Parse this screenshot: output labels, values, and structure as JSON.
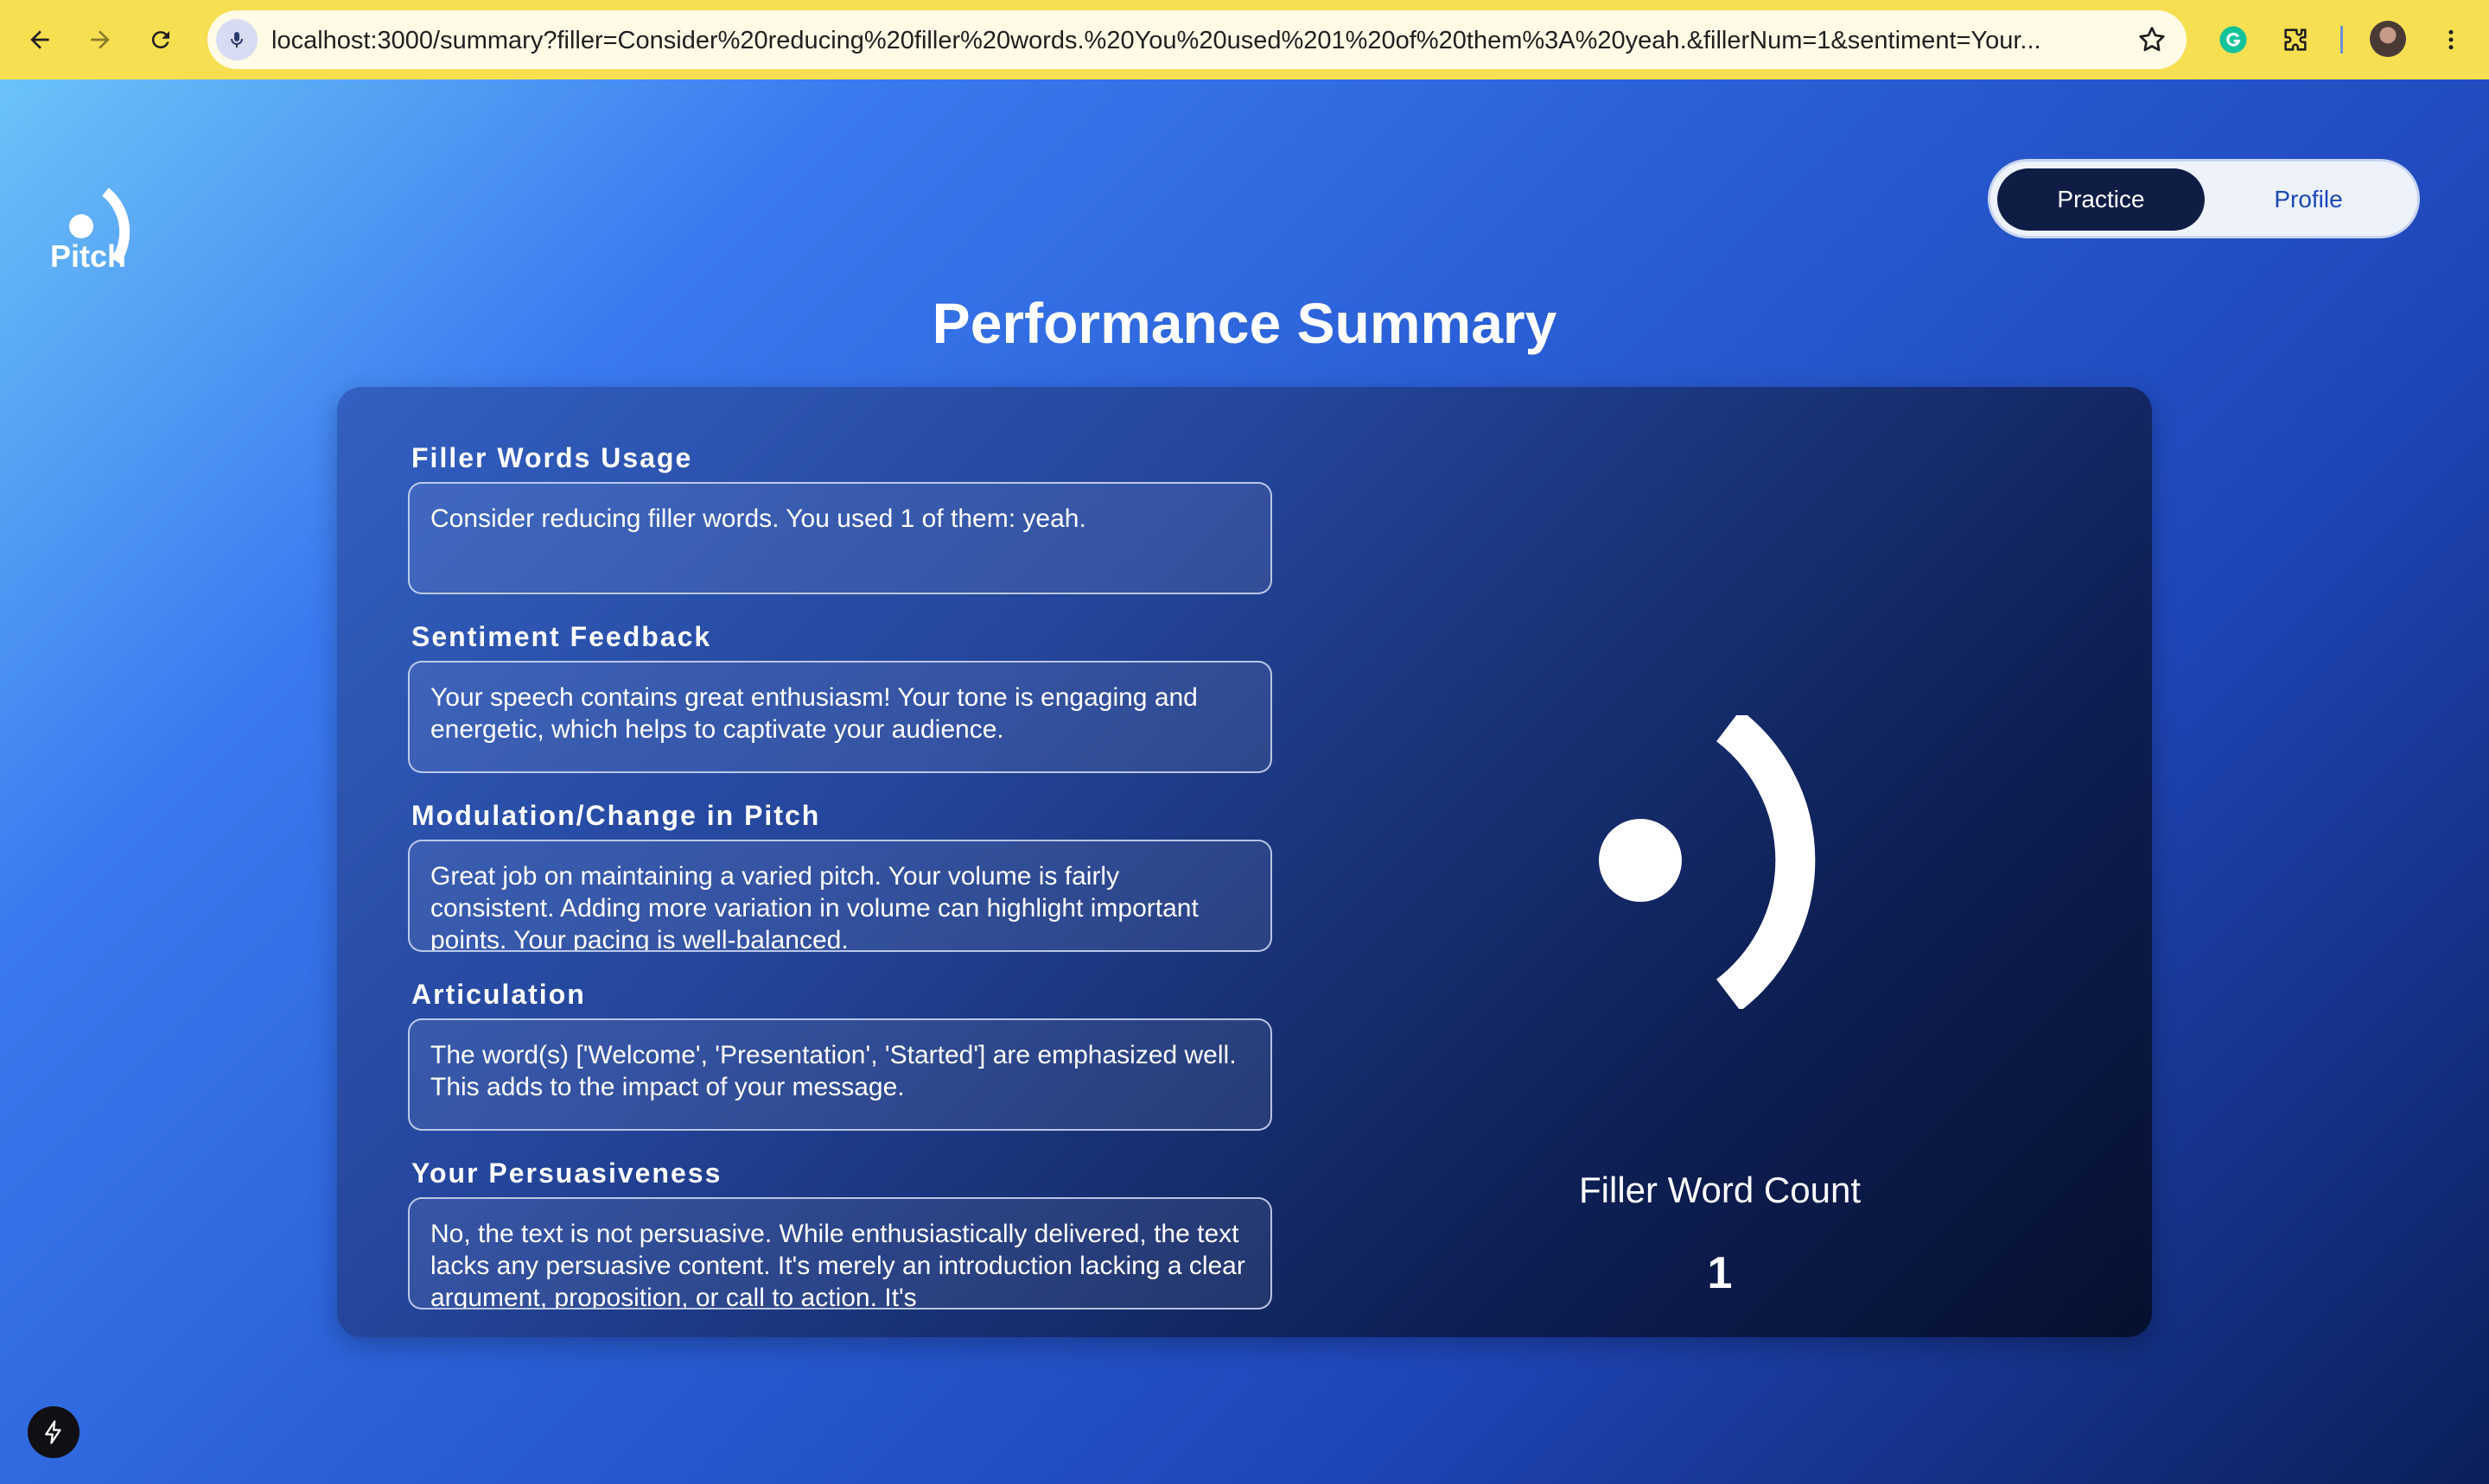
{
  "browser": {
    "url": "localhost:3000/summary?filler=Consider%20reducing%20filler%20words.%20You%20used%201%20of%20them%3A%20yeah.&fillerNum=1&sentiment=Your...",
    "accent": "#f7df52"
  },
  "brand": {
    "name": "Pitch"
  },
  "nav": {
    "practice_label": "Practice",
    "profile_label": "Profile",
    "active": "Practice"
  },
  "page": {
    "title": "Performance Summary"
  },
  "sections": [
    {
      "label": "Filler Words Usage",
      "text": "Consider reducing filler words. You used 1 of them: yeah."
    },
    {
      "label": "Sentiment Feedback",
      "text": "Your speech contains great enthusiasm! Your tone is engaging and energetic, which helps to captivate your audience."
    },
    {
      "label": "Modulation/Change in Pitch",
      "text": "Great job on maintaining a varied pitch. Your volume is fairly consistent. Adding more variation in volume can highlight important points. Your pacing is well-balanced."
    },
    {
      "label": "Articulation",
      "text": "The word(s) ['Welcome', 'Presentation', 'Started'] are emphasized well. This adds to the impact of your message."
    },
    {
      "label": "Your Persuasiveness",
      "text": "No, the text is not persuasive. While enthusiastically delivered, the text lacks any persuasive content. It's merely an introduction lacking a clear argument, proposition, or call to action. It's"
    }
  ],
  "filler_count": {
    "label": "Filler Word Count",
    "value": "1"
  }
}
